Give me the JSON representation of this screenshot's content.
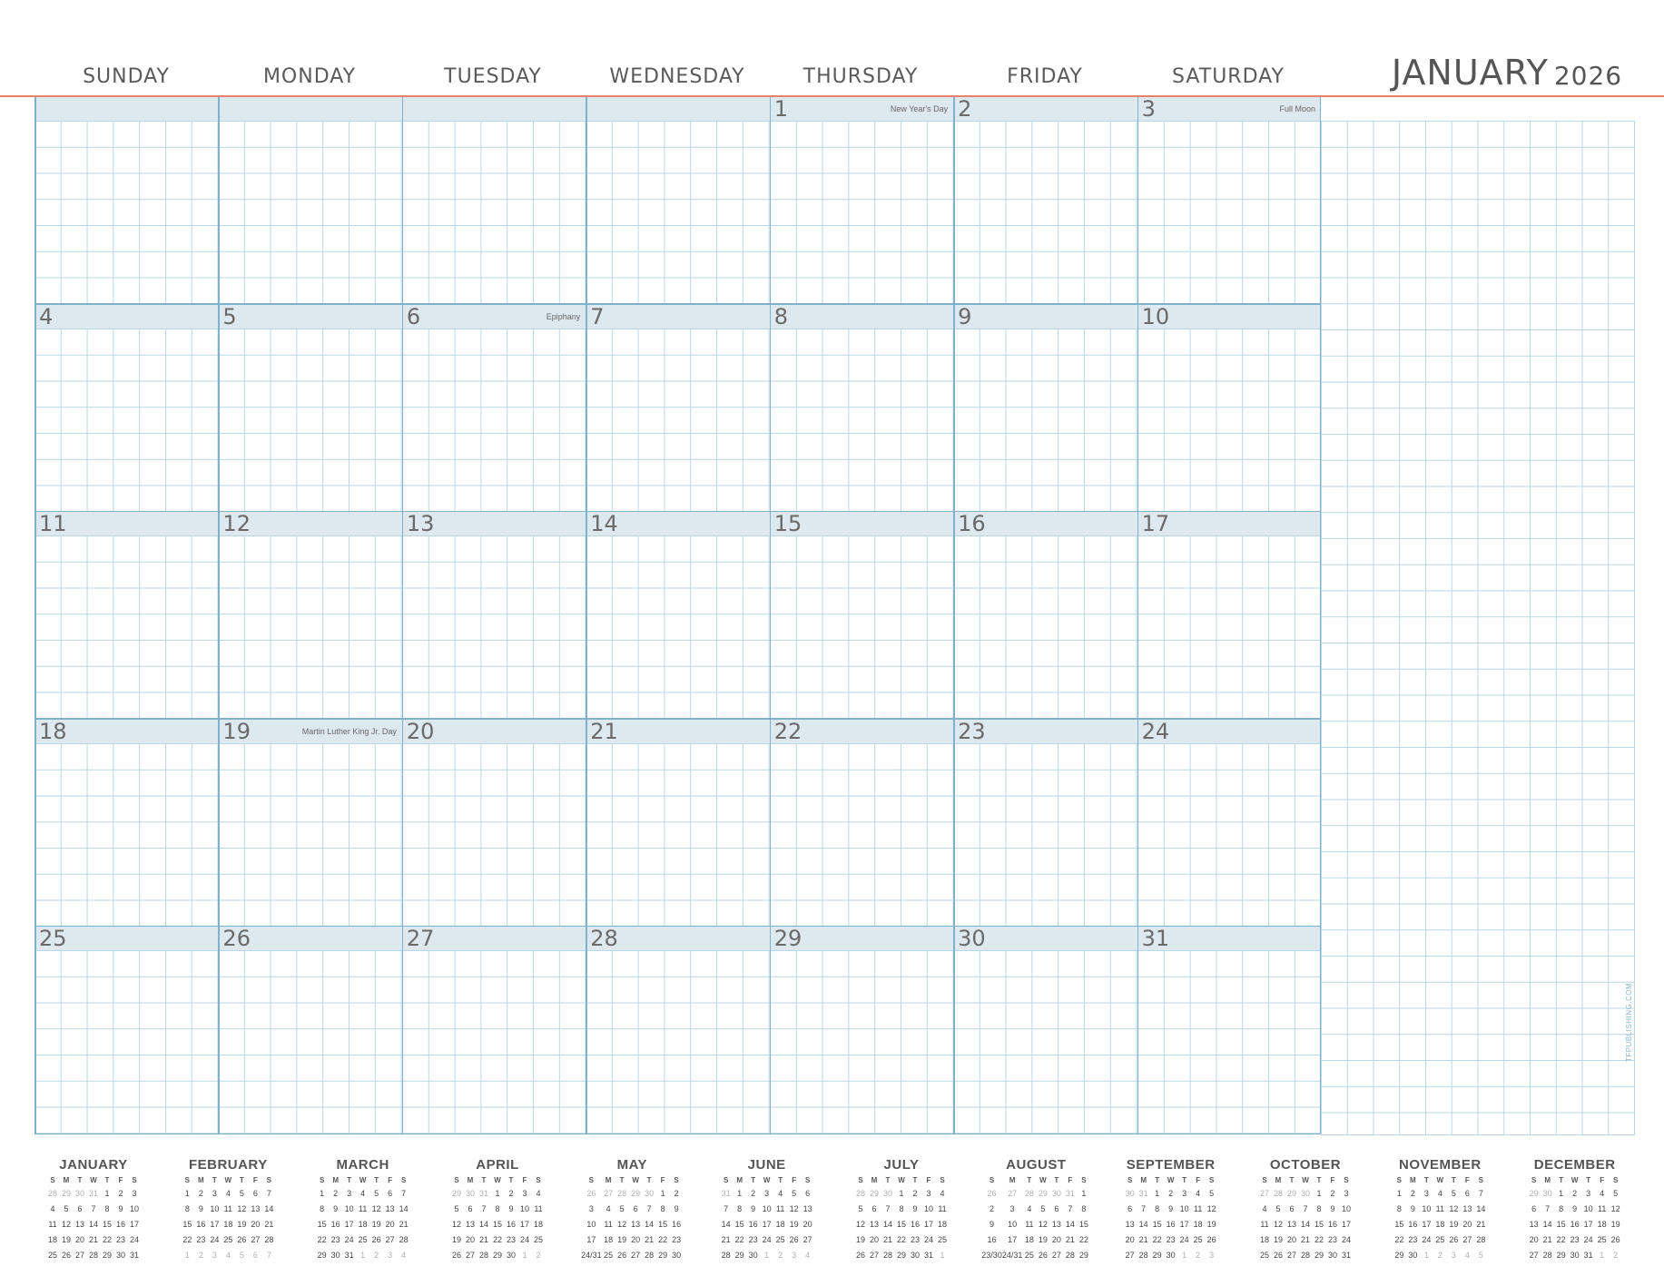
{
  "header": {
    "days": [
      "SUNDAY",
      "MONDAY",
      "TUESDAY",
      "WEDNESDAY",
      "THURSDAY",
      "FRIDAY",
      "SATURDAY"
    ],
    "month": "JANUARY",
    "year": "2026"
  },
  "colors": {
    "accent_rule": "#e8836a",
    "grid_line": "#b8d7e6",
    "cell_border": "#7fb0cc",
    "band": "#dde8ef"
  },
  "weeks": [
    [
      null,
      null,
      null,
      null,
      {
        "date": "1",
        "event": "New Year's Day"
      },
      {
        "date": "2",
        "event": ""
      },
      {
        "date": "3",
        "event": "Full Moon"
      }
    ],
    [
      {
        "date": "4",
        "event": ""
      },
      {
        "date": "5",
        "event": ""
      },
      {
        "date": "6",
        "event": "Epiphany"
      },
      {
        "date": "7",
        "event": ""
      },
      {
        "date": "8",
        "event": ""
      },
      {
        "date": "9",
        "event": ""
      },
      {
        "date": "10",
        "event": ""
      }
    ],
    [
      {
        "date": "11",
        "event": ""
      },
      {
        "date": "12",
        "event": ""
      },
      {
        "date": "13",
        "event": ""
      },
      {
        "date": "14",
        "event": ""
      },
      {
        "date": "15",
        "event": ""
      },
      {
        "date": "16",
        "event": ""
      },
      {
        "date": "17",
        "event": ""
      }
    ],
    [
      {
        "date": "18",
        "event": ""
      },
      {
        "date": "19",
        "event": "Martin Luther King Jr. Day"
      },
      {
        "date": "20",
        "event": ""
      },
      {
        "date": "21",
        "event": ""
      },
      {
        "date": "22",
        "event": ""
      },
      {
        "date": "23",
        "event": ""
      },
      {
        "date": "24",
        "event": ""
      }
    ],
    [
      {
        "date": "25",
        "event": ""
      },
      {
        "date": "26",
        "event": ""
      },
      {
        "date": "27",
        "event": ""
      },
      {
        "date": "28",
        "event": ""
      },
      {
        "date": "29",
        "event": ""
      },
      {
        "date": "30",
        "event": ""
      },
      {
        "date": "31",
        "event": ""
      }
    ]
  ],
  "credit": "TFPUBLISHING.COM",
  "mini_weekday_letters": [
    "S",
    "M",
    "T",
    "W",
    "T",
    "F",
    "S"
  ],
  "mini_calendars": [
    {
      "name": "JANUARY",
      "weeks": [
        [
          "28*",
          "29*",
          "30*",
          "31*",
          "1",
          "2",
          "3"
        ],
        [
          "4",
          "5",
          "6",
          "7",
          "8",
          "9",
          "10"
        ],
        [
          "11",
          "12",
          "13",
          "14",
          "15",
          "16",
          "17"
        ],
        [
          "18",
          "19",
          "20",
          "21",
          "22",
          "23",
          "24"
        ],
        [
          "25",
          "26",
          "27",
          "28",
          "29",
          "30",
          "31"
        ]
      ]
    },
    {
      "name": "FEBRUARY",
      "weeks": [
        [
          "1",
          "2",
          "3",
          "4",
          "5",
          "6",
          "7"
        ],
        [
          "8",
          "9",
          "10",
          "11",
          "12",
          "13",
          "14"
        ],
        [
          "15",
          "16",
          "17",
          "18",
          "19",
          "20",
          "21"
        ],
        [
          "22",
          "23",
          "24",
          "25",
          "26",
          "27",
          "28"
        ],
        [
          "1*",
          "2*",
          "3*",
          "4*",
          "5*",
          "6*",
          "7*"
        ]
      ]
    },
    {
      "name": "MARCH",
      "weeks": [
        [
          "1",
          "2",
          "3",
          "4",
          "5",
          "6",
          "7"
        ],
        [
          "8",
          "9",
          "10",
          "11",
          "12",
          "13",
          "14"
        ],
        [
          "15",
          "16",
          "17",
          "18",
          "19",
          "20",
          "21"
        ],
        [
          "22",
          "23",
          "24",
          "25",
          "26",
          "27",
          "28"
        ],
        [
          "29",
          "30",
          "31",
          "1*",
          "2*",
          "3*",
          "4*"
        ]
      ]
    },
    {
      "name": "APRIL",
      "weeks": [
        [
          "29*",
          "30*",
          "31*",
          "1",
          "2",
          "3",
          "4"
        ],
        [
          "5",
          "6",
          "7",
          "8",
          "9",
          "10",
          "11"
        ],
        [
          "12",
          "13",
          "14",
          "15",
          "16",
          "17",
          "18"
        ],
        [
          "19",
          "20",
          "21",
          "22",
          "23",
          "24",
          "25"
        ],
        [
          "26",
          "27",
          "28",
          "29",
          "30",
          "1*",
          "2*"
        ]
      ]
    },
    {
      "name": "MAY",
      "weeks": [
        [
          "26*",
          "27*",
          "28*",
          "29*",
          "30*",
          "1",
          "2"
        ],
        [
          "3",
          "4",
          "5",
          "6",
          "7",
          "8",
          "9"
        ],
        [
          "10",
          "11",
          "12",
          "13",
          "14",
          "15",
          "16"
        ],
        [
          "17",
          "18",
          "19",
          "20",
          "21",
          "22",
          "23"
        ],
        [
          "24/31",
          "25",
          "26",
          "27",
          "28",
          "29",
          "30"
        ]
      ]
    },
    {
      "name": "JUNE",
      "weeks": [
        [
          "31*",
          "1",
          "2",
          "3",
          "4",
          "5",
          "6"
        ],
        [
          "7",
          "8",
          "9",
          "10",
          "11",
          "12",
          "13"
        ],
        [
          "14",
          "15",
          "16",
          "17",
          "18",
          "19",
          "20"
        ],
        [
          "21",
          "22",
          "23",
          "24",
          "25",
          "26",
          "27"
        ],
        [
          "28",
          "29",
          "30",
          "1*",
          "2*",
          "3*",
          "4*"
        ]
      ]
    },
    {
      "name": "JULY",
      "weeks": [
        [
          "28*",
          "29*",
          "30*",
          "1",
          "2",
          "3",
          "4"
        ],
        [
          "5",
          "6",
          "7",
          "8",
          "9",
          "10",
          "11"
        ],
        [
          "12",
          "13",
          "14",
          "15",
          "16",
          "17",
          "18"
        ],
        [
          "19",
          "20",
          "21",
          "22",
          "23",
          "24",
          "25"
        ],
        [
          "26",
          "27",
          "28",
          "29",
          "30",
          "31",
          "1*"
        ]
      ]
    },
    {
      "name": "AUGUST",
      "weeks": [
        [
          "26*",
          "27*",
          "28*",
          "29*",
          "30*",
          "31*",
          "1"
        ],
        [
          "2",
          "3",
          "4",
          "5",
          "6",
          "7",
          "8"
        ],
        [
          "9",
          "10",
          "11",
          "12",
          "13",
          "14",
          "15"
        ],
        [
          "16",
          "17",
          "18",
          "19",
          "20",
          "21",
          "22"
        ],
        [
          "23/30",
          "24/31",
          "25",
          "26",
          "27",
          "28",
          "29"
        ]
      ]
    },
    {
      "name": "SEPTEMBER",
      "weeks": [
        [
          "30*",
          "31*",
          "1",
          "2",
          "3",
          "4",
          "5"
        ],
        [
          "6",
          "7",
          "8",
          "9",
          "10",
          "11",
          "12"
        ],
        [
          "13",
          "14",
          "15",
          "16",
          "17",
          "18",
          "19"
        ],
        [
          "20",
          "21",
          "22",
          "23",
          "24",
          "25",
          "26"
        ],
        [
          "27",
          "28",
          "29",
          "30",
          "1*",
          "2*",
          "3*"
        ]
      ]
    },
    {
      "name": "OCTOBER",
      "weeks": [
        [
          "27*",
          "28*",
          "29*",
          "30*",
          "1",
          "2",
          "3"
        ],
        [
          "4",
          "5",
          "6",
          "7",
          "8",
          "9",
          "10"
        ],
        [
          "11",
          "12",
          "13",
          "14",
          "15",
          "16",
          "17"
        ],
        [
          "18",
          "19",
          "20",
          "21",
          "22",
          "23",
          "24"
        ],
        [
          "25",
          "26",
          "27",
          "28",
          "29",
          "30",
          "31"
        ]
      ]
    },
    {
      "name": "NOVEMBER",
      "weeks": [
        [
          "1",
          "2",
          "3",
          "4",
          "5",
          "6",
          "7"
        ],
        [
          "8",
          "9",
          "10",
          "11",
          "12",
          "13",
          "14"
        ],
        [
          "15",
          "16",
          "17",
          "18",
          "19",
          "20",
          "21"
        ],
        [
          "22",
          "23",
          "24",
          "25",
          "26",
          "27",
          "28"
        ],
        [
          "29",
          "30",
          "1*",
          "2*",
          "3*",
          "4*",
          "5*"
        ]
      ]
    },
    {
      "name": "DECEMBER",
      "weeks": [
        [
          "29*",
          "30*",
          "1",
          "2",
          "3",
          "4",
          "5"
        ],
        [
          "6",
          "7",
          "8",
          "9",
          "10",
          "11",
          "12"
        ],
        [
          "13",
          "14",
          "15",
          "16",
          "17",
          "18",
          "19"
        ],
        [
          "20",
          "21",
          "22",
          "23",
          "24",
          "25",
          "26"
        ],
        [
          "27",
          "28",
          "29",
          "30",
          "31",
          "1*",
          "2*"
        ]
      ]
    }
  ]
}
